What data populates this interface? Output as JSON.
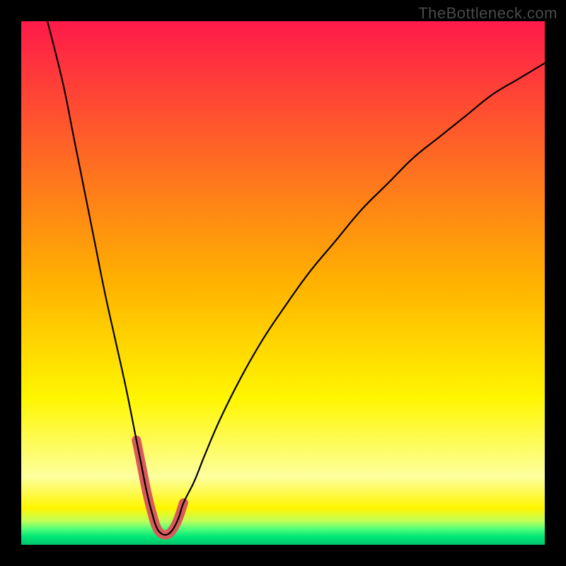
{
  "watermark": "TheBottleneck.com",
  "gradient_stops": [
    {
      "offset": 0.0,
      "color": "#ff1a4a"
    },
    {
      "offset": 0.5,
      "color": "#ffb200"
    },
    {
      "offset": 0.72,
      "color": "#fff600"
    },
    {
      "offset": 0.87,
      "color": "#fdff9e"
    },
    {
      "offset": 0.93,
      "color": "#fff600"
    },
    {
      "offset": 0.955,
      "color": "#bfff59"
    },
    {
      "offset": 0.97,
      "color": "#4fff7a"
    },
    {
      "offset": 0.985,
      "color": "#00e676"
    },
    {
      "offset": 1.0,
      "color": "#00c46a"
    }
  ],
  "curve_color": "#000000",
  "curve_width": 2.2,
  "highlight_color": "#d85a5a",
  "highlight_width": 13,
  "chart_data": {
    "type": "line",
    "title": "",
    "xlabel": "",
    "ylabel": "",
    "xlim": [
      0,
      100
    ],
    "ylim": [
      0,
      100
    ],
    "series": [
      {
        "name": "curve",
        "x": [
          5,
          8,
          10,
          12,
          14,
          16,
          18,
          20,
          22,
          23,
          24,
          25,
          26,
          27,
          28,
          29,
          30,
          31,
          33,
          35,
          38,
          42,
          46,
          50,
          55,
          60,
          65,
          70,
          75,
          80,
          85,
          90,
          95,
          100
        ],
        "y": [
          100,
          88,
          78,
          68,
          58,
          48,
          39,
          30,
          20,
          15,
          10,
          6,
          3,
          2,
          2,
          3,
          5,
          8,
          12,
          17,
          24,
          32,
          39,
          45,
          52,
          58,
          64,
          69,
          74,
          78,
          82,
          86,
          89,
          92
        ]
      },
      {
        "name": "highlight",
        "x": [
          22,
          23,
          24,
          25,
          26,
          27,
          28,
          29,
          30,
          31
        ],
        "y": [
          20,
          15,
          10,
          6,
          3,
          2,
          2,
          3,
          5,
          8
        ]
      }
    ]
  }
}
